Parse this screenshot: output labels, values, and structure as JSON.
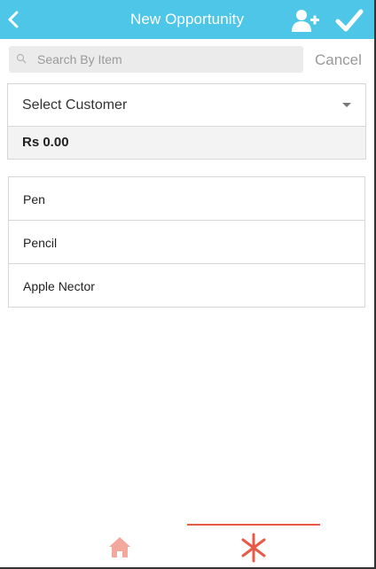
{
  "header": {
    "title": "New Opportunity",
    "back_icon": "chevron-left-icon",
    "add_user_icon": "add-user-icon",
    "confirm_icon": "checkmark-icon",
    "background_color": "#4dc6e8"
  },
  "search": {
    "placeholder": "Search By Item",
    "value": "",
    "cancel_label": "Cancel"
  },
  "customer": {
    "select_label": "Select Customer",
    "amount": "Rs 0.00"
  },
  "items": [
    {
      "label": "Pen"
    },
    {
      "label": "Pencil"
    },
    {
      "label": "Apple Nector"
    }
  ],
  "bottom_nav": {
    "tabs": [
      {
        "icon": "home-icon",
        "active": false
      },
      {
        "icon": "asterisk-icon",
        "active": true
      }
    ],
    "accent_color": "#e85a47"
  }
}
